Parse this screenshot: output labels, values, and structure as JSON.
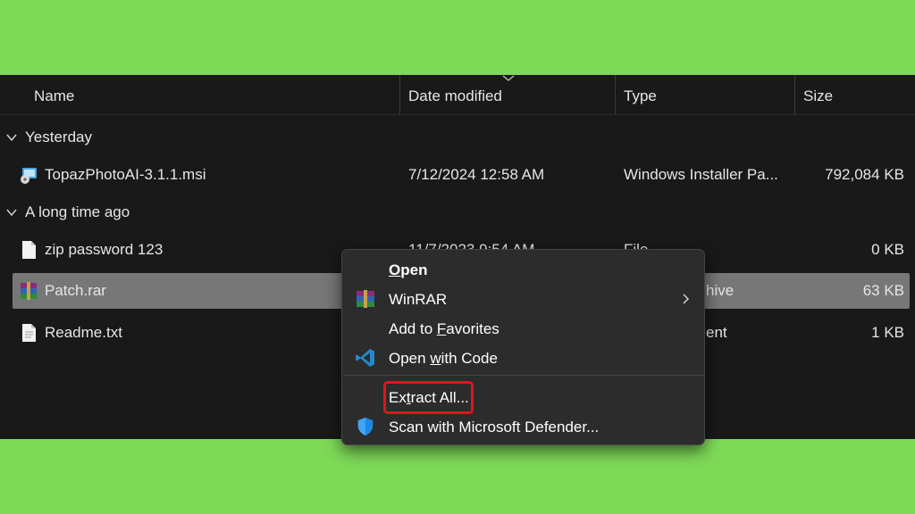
{
  "colors": {
    "frame": "#7ed957",
    "background": "#191919",
    "selection": "#777777",
    "menu": "#2c2c2c",
    "highlight": "#e0161b"
  },
  "columns": {
    "name": "Name",
    "date": "Date modified",
    "type": "Type",
    "size": "Size"
  },
  "groups": [
    {
      "label": "Yesterday",
      "icon": "chevron-down-icon"
    },
    {
      "label": "A long time ago",
      "icon": "chevron-down-icon"
    }
  ],
  "files": [
    {
      "name": "TopazPhotoAI-3.1.1.msi",
      "date": "7/12/2024 12:58 AM",
      "type": "Windows Installer Pa...",
      "size": "792,084 KB",
      "icon": "msi-installer-icon"
    },
    {
      "name": "zip password 123",
      "date": "11/7/2023 9:54 AM",
      "type": "File",
      "size": "0 KB",
      "icon": "blank-file-icon"
    },
    {
      "name": "Patch.rar",
      "date": "",
      "type": "hive",
      "size": "63 KB",
      "icon": "winrar-archive-icon",
      "selected": true
    },
    {
      "name": "Readme.txt",
      "date": "",
      "type": "ent",
      "size": "1 KB",
      "icon": "text-file-icon"
    }
  ],
  "context_menu": {
    "open": {
      "pre": "",
      "accel": "O",
      "post": "pen"
    },
    "winrar": "WinRAR",
    "favorites": {
      "pre": "Add to ",
      "accel": "F",
      "post": "avorites"
    },
    "code": {
      "pre": "Open ",
      "accel": "w",
      "post": "ith Code"
    },
    "extract": {
      "pre": "Ex",
      "accel": "t",
      "post": "ract All..."
    },
    "defender": "Scan with Microsoft Defender..."
  }
}
